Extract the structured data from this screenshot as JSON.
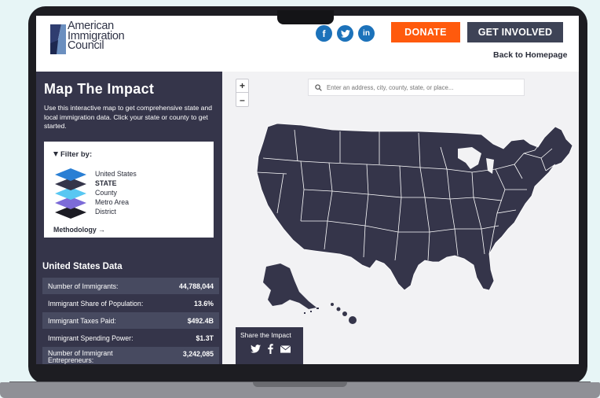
{
  "header": {
    "logo_lines": [
      "American",
      "Immigration",
      "Council"
    ],
    "social": [
      {
        "icon": "facebook-icon",
        "glyph": "f"
      },
      {
        "icon": "twitter-icon",
        "glyph": "t"
      },
      {
        "icon": "linkedin-icon",
        "glyph": "in"
      }
    ],
    "donate_label": "DONATE",
    "involved_label": "GET INVOLVED",
    "back_label": "Back to Homepage",
    "colors": {
      "donate": "#ff5a0d",
      "involved": "#3e4356",
      "social": "#1c72ba"
    }
  },
  "sidebar": {
    "title": "Map The Impact",
    "description": "Use this interactive map to get comprehensive state and local immigration data. Click your state or county to get started.",
    "filter": {
      "title": "Filter by:",
      "layers": [
        {
          "label": "United States",
          "selected": false,
          "color": "#2a7fd4"
        },
        {
          "label": "STATE",
          "selected": true,
          "color": "#35354a"
        },
        {
          "label": "County",
          "selected": false,
          "color": "#58c7f2"
        },
        {
          "label": "Metro Area",
          "selected": false,
          "color": "#7c6bd8"
        },
        {
          "label": "District",
          "selected": false,
          "color": "#1c1c24"
        }
      ],
      "methodology_label": "Methodology →"
    },
    "us_data": {
      "title": "United States Data",
      "rows": [
        {
          "label": "Number of Immigrants:",
          "value": "44,788,044"
        },
        {
          "label": "Immigrant Share of Population:",
          "value": "13.6%"
        },
        {
          "label": "Immigrant Taxes Paid:",
          "value": "$492.4B"
        },
        {
          "label": "Immigrant Spending Power:",
          "value": "$1.3T"
        },
        {
          "label": "Number of Immigrant Entrepreneurs:",
          "value": "3,242,085"
        }
      ]
    }
  },
  "map": {
    "zoom_in": "+",
    "zoom_out": "–",
    "search_placeholder": "Enter an address, city, county, state, or place...",
    "share_title": "Share the Impact",
    "state_fill": "#35354a",
    "share_icons": [
      "twitter-icon",
      "facebook-icon",
      "email-icon"
    ]
  }
}
